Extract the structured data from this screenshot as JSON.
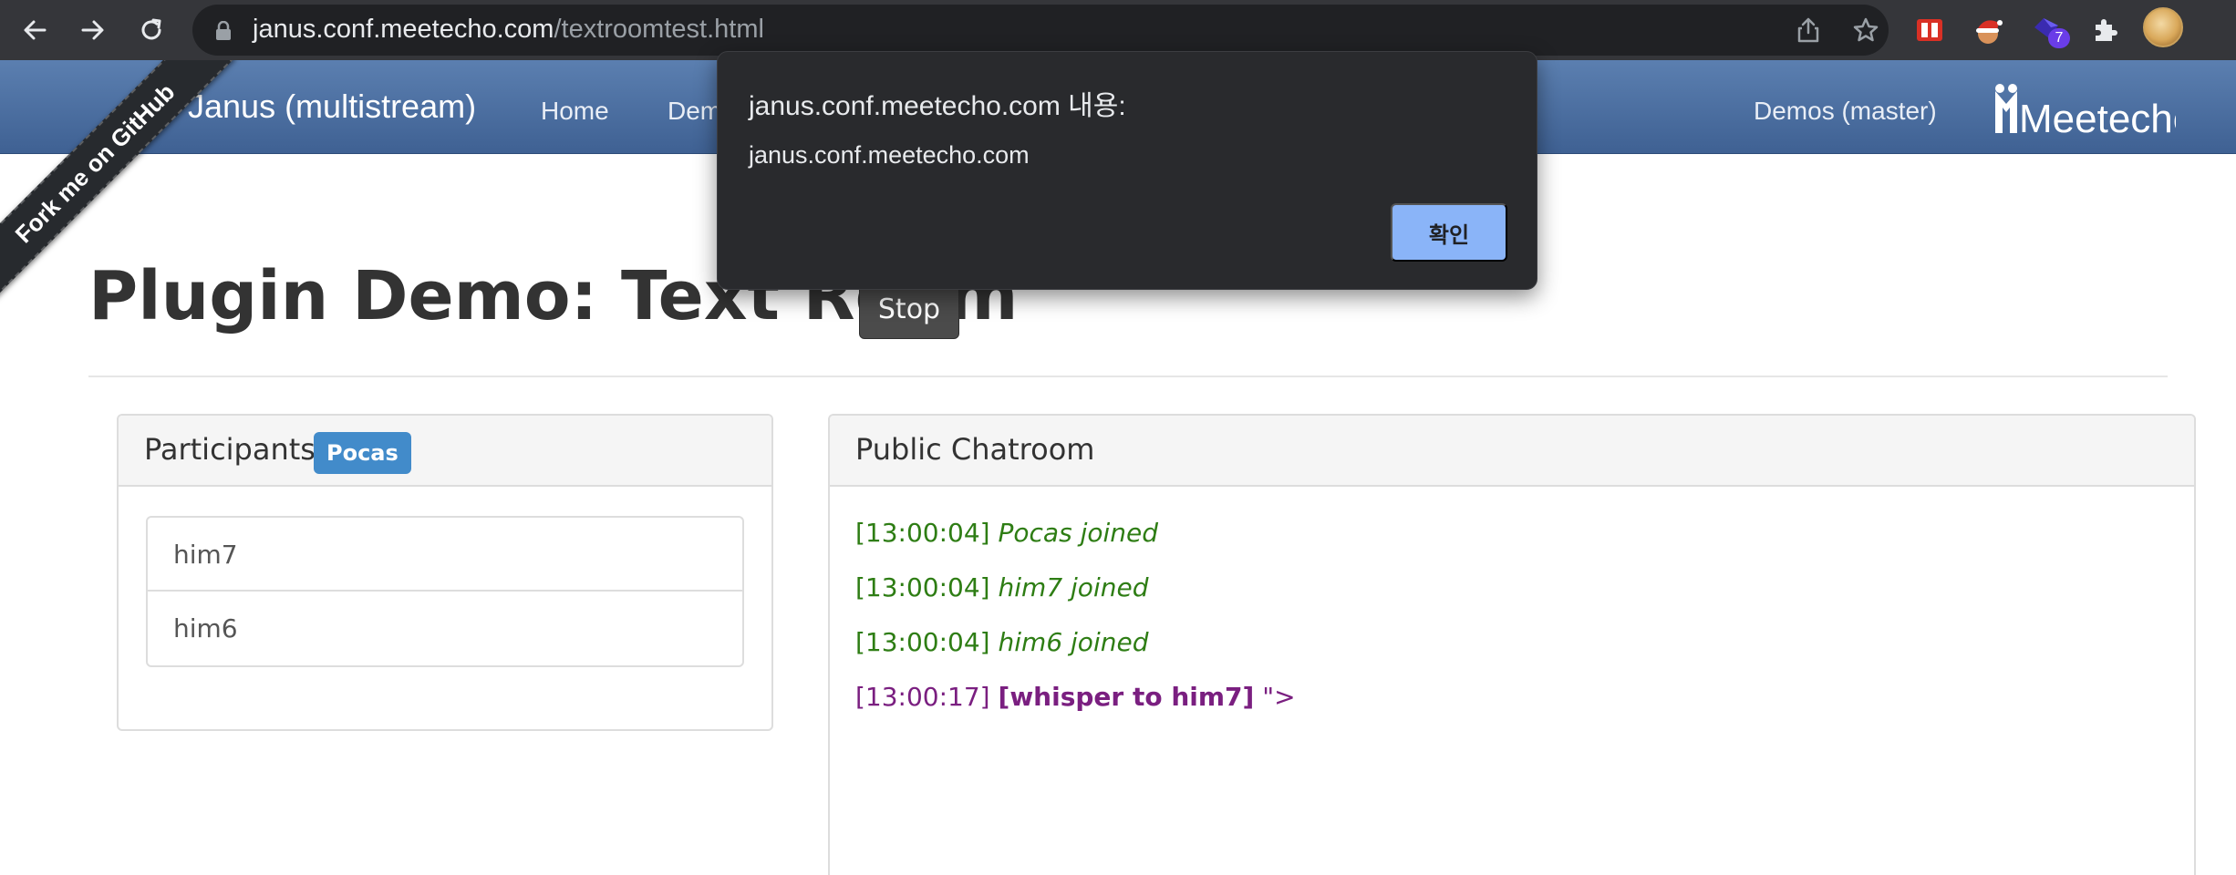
{
  "browser": {
    "url_host": "janus.conf.meetecho.com",
    "url_path": "/textroomtest.html",
    "extension_badge": "7"
  },
  "navbar": {
    "brand": "Janus (multistream)",
    "links": [
      "Home",
      "Dem"
    ],
    "right_link": "Demos (master)",
    "logo_text": "Meetecho"
  },
  "ribbon": {
    "label": "Fork me on GitHub"
  },
  "page": {
    "title": "Plugin Demo: Text Room",
    "stop_label": "Stop"
  },
  "participants": {
    "title": "Participants",
    "badge": "Pocas",
    "items": [
      "him7",
      "him6"
    ]
  },
  "chatroom": {
    "title": "Public Chatroom",
    "messages": [
      {
        "time": "[13:00:04]",
        "text": "Pocas joined"
      },
      {
        "time": "[13:00:04]",
        "text": "him7 joined"
      },
      {
        "time": "[13:00:04]",
        "text": "him6 joined"
      },
      {
        "time": "[13:00:17]",
        "text": "[whisper to him7]",
        "suffix": "\">"
      }
    ]
  },
  "dialog": {
    "title": "janus.conf.meetecho.com 내용:",
    "message": "janus.conf.meetecho.com",
    "ok_label": "확인"
  },
  "colors": {
    "navbar": "#4a6fa3",
    "chrome": "#35363a",
    "joined_text": "#2e7d14",
    "whisper_text": "#7a1f80",
    "badge": "#428bca",
    "dialog_button": "#8ab4f8"
  }
}
